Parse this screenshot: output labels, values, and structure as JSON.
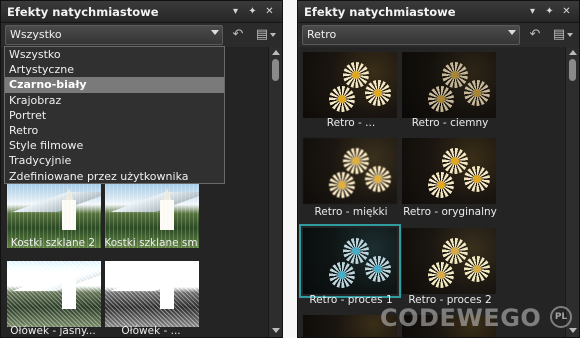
{
  "left_panel": {
    "title": "Efekty natychmiastowe",
    "title_controls": [
      "▾",
      "✕",
      "✕"
    ],
    "category_select_value": "Wszystko",
    "dropdown_options": [
      "Wszystko",
      "Artystyczne",
      "Czarno-biały",
      "Krajobraz",
      "Portret",
      "Retro",
      "Style filmowe",
      "Tradycyjnie",
      "Zdefiniowane przez użytkownika"
    ],
    "dropdown_selected_index": 2,
    "thumbnails": [
      {
        "label": "Kostki szklane 2"
      },
      {
        "label": "Kostki szklane sm"
      },
      {
        "label": "Ołówek - jasny..."
      },
      {
        "label": "Ołówek - ..."
      }
    ]
  },
  "right_panel": {
    "title": "Efekty natychmiastowe",
    "category_select_value": "Retro",
    "thumbnails": [
      {
        "label": "Retro - ..."
      },
      {
        "label": "Retro - ciemny"
      },
      {
        "label": "Retro - miękki"
      },
      {
        "label": "Retro - oryginalny"
      },
      {
        "label": "Retro - proces 1"
      },
      {
        "label": "Retro - proces 2"
      }
    ],
    "selected_thumbnail_index": 4
  },
  "watermark": {
    "text": "CODEWEGO",
    "badge": "PL"
  },
  "colors": {
    "panel_bg": "#232323",
    "selection_outline": "#e08a1e",
    "dropdown_highlight": "#7a7a7a"
  },
  "icons": {
    "pin": "pin-icon",
    "close": "close-icon",
    "menu": "menu-chevron-icon",
    "reset": "undo-icon",
    "options": "options-icon"
  }
}
